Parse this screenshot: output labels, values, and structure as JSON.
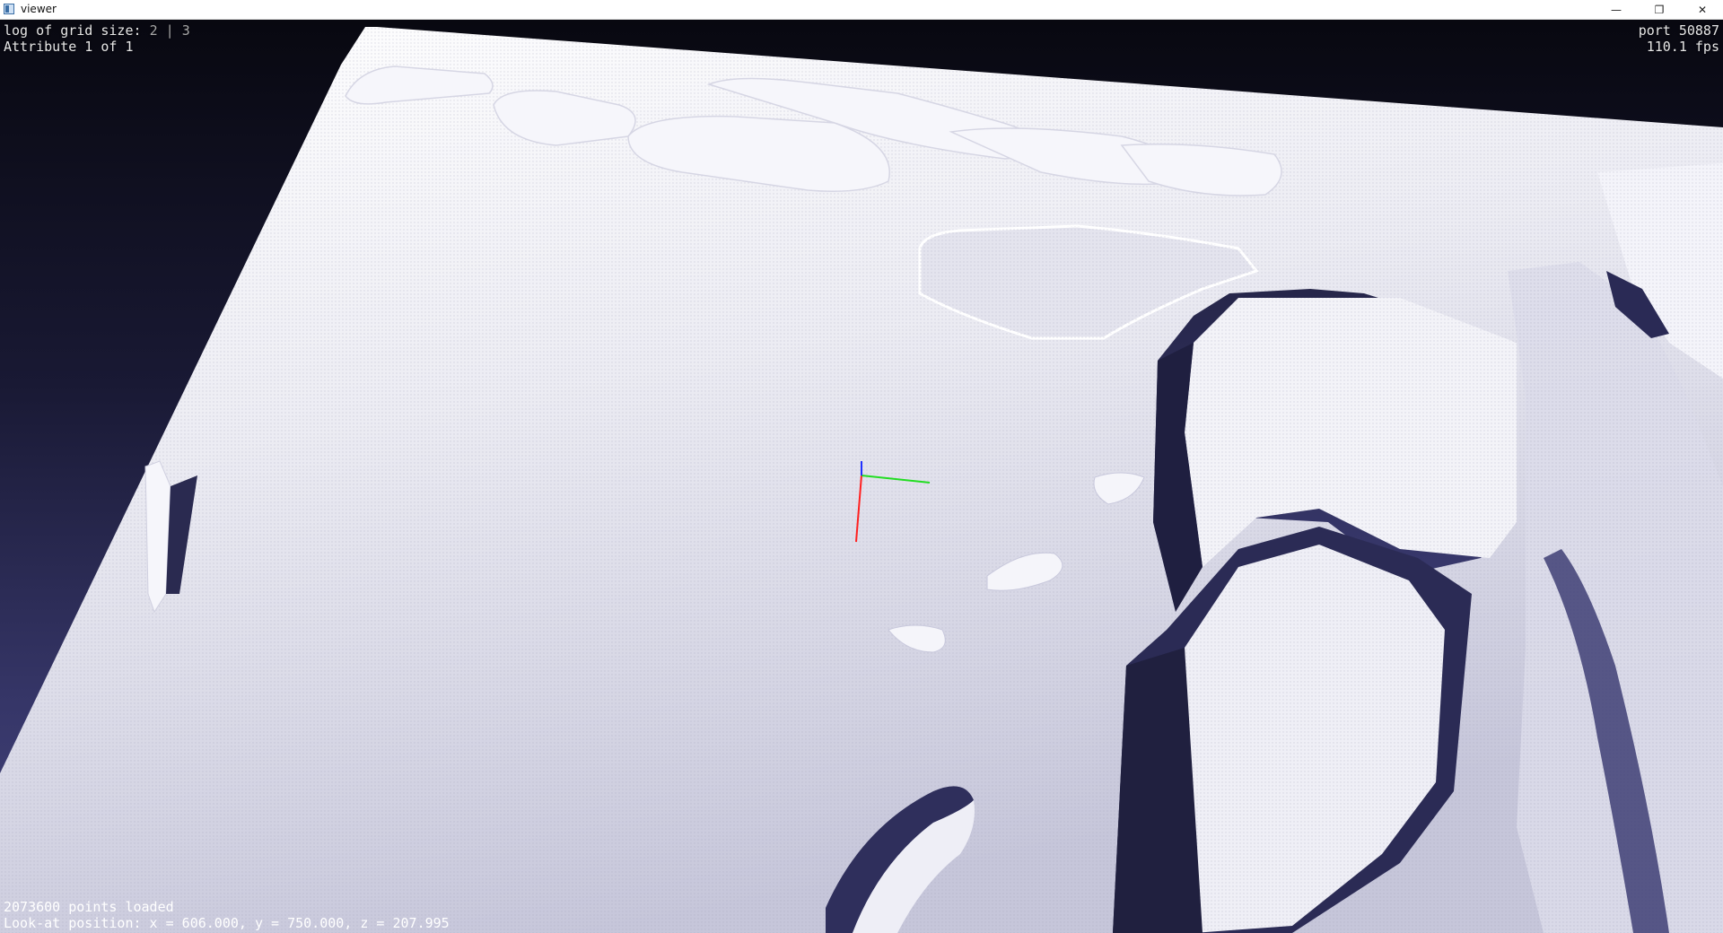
{
  "window": {
    "title": "viewer",
    "icon": "app-window-icon",
    "minimize_glyph": "—",
    "maximize_glyph": "❐",
    "close_glyph": "✕"
  },
  "hud": {
    "grid_label": "log of grid size:",
    "grid_value_1": "2",
    "grid_separator": "|",
    "grid_value_2": "3",
    "attribute": "Attribute 1 of 1",
    "port": "port 50887",
    "fps": "110.1 fps",
    "points_loaded": "2073600 points loaded",
    "look_at": "Look-at position: x = 606.000, y = 750.000, z = 207.995"
  },
  "colors": {
    "background_top": "#080810",
    "background_bottom": "#45457f",
    "terrain": "#f0f0f6",
    "axis_x": "#ff2020",
    "axis_y": "#22dd22",
    "axis_z": "#2030ff"
  }
}
